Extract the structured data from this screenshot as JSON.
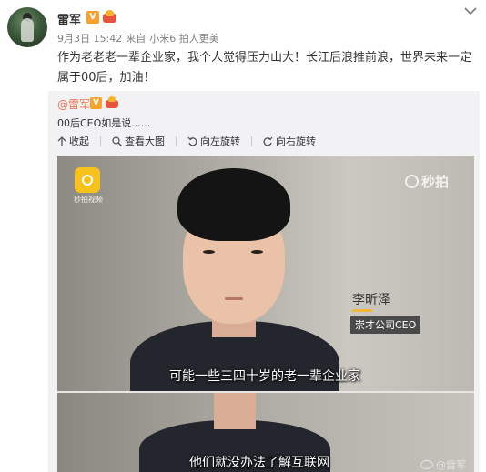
{
  "post": {
    "author": "雷军",
    "meta": {
      "date": "9月3日 15:42",
      "source_prefix": "来自",
      "source": "小米6 拍人更美"
    },
    "content": "作为老老老一辈企业家，我个人觉得压力山大！长江后浪推前浪，世界未来一定属于00后，加油！"
  },
  "repost": {
    "author": "@雷军",
    "text": "00后CEO如是说......",
    "toolbar": {
      "collapse": "收起",
      "view_large": "查看大图",
      "rotate_left": "向左旋转",
      "rotate_right": "向右旋转"
    }
  },
  "video": {
    "watermark": "秒拍",
    "logo_caption": "秒拍视频",
    "person_name": "李昕泽",
    "person_title": "崇才公司CEO",
    "subtitle_1": "可能一些三四十岁的老一辈企业家",
    "subtitle_2": "他们就没办法了解互联网",
    "weibo_watermark": "@雷军"
  },
  "colors": {
    "username_link": "#eb7350",
    "verified_badge": "#f9a12b",
    "repost_bg": "#f2f2f5",
    "miaopai_yellow": "#f7c21b"
  },
  "icons": [
    "chevron-down-icon",
    "collapse-arrow-icon",
    "magnifier-icon",
    "rotate-left-icon",
    "rotate-right-icon",
    "verified-v-icon",
    "member-crown-icon"
  ]
}
